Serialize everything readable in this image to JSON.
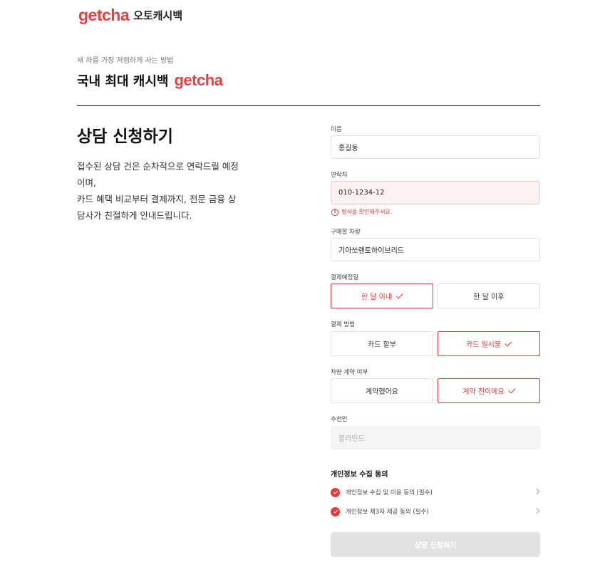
{
  "header": {
    "brand": "getcha",
    "brand_sub": "오토캐시백"
  },
  "hero": {
    "tagline": "새 차를 가장 저렴하게 사는 방법",
    "headline": "국내 최대 캐시백",
    "headline_brand": "getcha"
  },
  "intro": {
    "title": "상담 신청하기",
    "lines": [
      "접수된 상담 건은 순차적으로 연락드릴 예정",
      "이며,",
      "카드 혜택 비교부터 결제까지, 전문 금융 상",
      "담사가 친절하게 안내드립니다."
    ]
  },
  "form": {
    "name": {
      "label": "이름",
      "value": "홍길동"
    },
    "phone": {
      "label": "연락처",
      "value": "010-1234-12",
      "error": "형식을 확인해주세요."
    },
    "car": {
      "label": "구매할 차량",
      "value": "기아쏘렌토하이브리드"
    },
    "payment_date": {
      "label": "결제예정일",
      "options": [
        "한 달 이내",
        "한 달 이후"
      ],
      "selected": "한 달 이내"
    },
    "payment_method": {
      "label": "결제 방법",
      "options": [
        "카드 할부",
        "카드 일시불"
      ],
      "selected": "카드 일시불"
    },
    "contract": {
      "label": "차량 계약 여부",
      "options": [
        "계약했어요",
        "계약 전이에요"
      ],
      "selected": "계약 전이에요"
    },
    "referrer": {
      "label": "추천인",
      "placeholder": "블라인드"
    }
  },
  "consent": {
    "title": "개인정보 수집 동의",
    "items": [
      "개인정보 수집 및 이용 동의 (필수)",
      "개인정보 제3자 제공 동의 (필수)"
    ]
  },
  "submit_label": "상담 신청하기",
  "colors": {
    "brand": "#ea3f3f",
    "error_bg": "#fdf2f2",
    "disabled_button": "#e2e2e2"
  }
}
